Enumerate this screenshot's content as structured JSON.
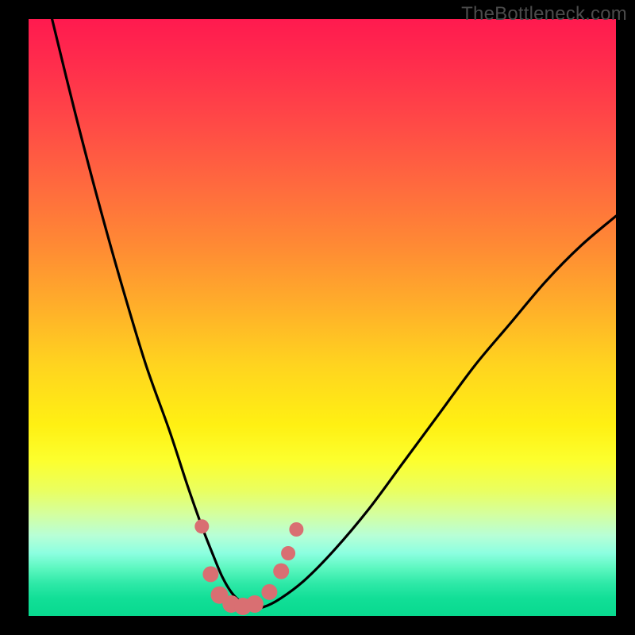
{
  "watermark": "TheBottleneck.com",
  "colors": {
    "frame": "#000000",
    "curve": "#000000",
    "markers": "#d96f72"
  },
  "chart_data": {
    "type": "line",
    "title": "",
    "xlabel": "",
    "ylabel": "",
    "xlim": [
      0,
      100
    ],
    "ylim": [
      0,
      100
    ],
    "series": [
      {
        "name": "bottleneck-curve",
        "x": [
          4,
          8,
          12,
          16,
          20,
          24,
          27,
          29.5,
          31.5,
          33,
          34.5,
          36,
          38,
          40,
          43,
          47,
          52,
          58,
          64,
          70,
          76,
          82,
          88,
          94,
          100
        ],
        "y": [
          100,
          84,
          69,
          55,
          42,
          31,
          22,
          15,
          10,
          6.5,
          4,
          2.5,
          1.5,
          1.5,
          3,
          6,
          11,
          18,
          26,
          34,
          42,
          49,
          56,
          62,
          67
        ]
      }
    ],
    "markers": [
      {
        "x": 29.5,
        "y": 15,
        "r": 9
      },
      {
        "x": 31.0,
        "y": 7,
        "r": 10
      },
      {
        "x": 32.5,
        "y": 3.5,
        "r": 11
      },
      {
        "x": 34.5,
        "y": 2.0,
        "r": 11
      },
      {
        "x": 36.5,
        "y": 1.6,
        "r": 11
      },
      {
        "x": 38.5,
        "y": 2.0,
        "r": 11
      },
      {
        "x": 41.0,
        "y": 4.0,
        "r": 10
      },
      {
        "x": 43.0,
        "y": 7.5,
        "r": 10
      },
      {
        "x": 44.2,
        "y": 10.5,
        "r": 9
      },
      {
        "x": 45.6,
        "y": 14.5,
        "r": 9
      }
    ],
    "gradient_stops": [
      {
        "pos": 0.0,
        "color": "#ff1a4f"
      },
      {
        "pos": 0.3,
        "color": "#ff7a38"
      },
      {
        "pos": 0.6,
        "color": "#ffe018"
      },
      {
        "pos": 0.78,
        "color": "#f6ff40"
      },
      {
        "pos": 0.88,
        "color": "#b8ffd6"
      },
      {
        "pos": 1.0,
        "color": "#08d98f"
      }
    ]
  }
}
